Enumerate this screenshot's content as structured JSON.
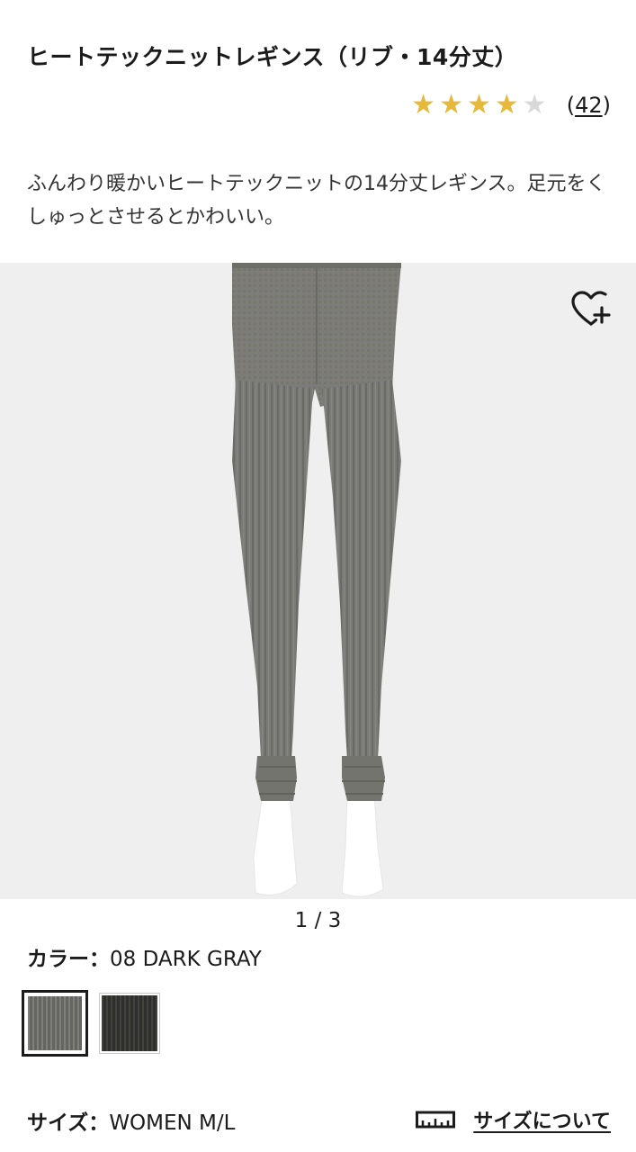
{
  "product": {
    "title": "ヒートテックニットレギンス（リブ・14分丈）",
    "rating": {
      "value": 4,
      "max": 5,
      "review_count": "(42)",
      "review_count_num": "42",
      "star_on_color": "#e6b93b",
      "star_off_color": "#d9d9d9"
    },
    "description": "ふんわり暖かいヒートテックニットの14分丈レギンス。足元をくしゅっとさせるとかわいい。"
  },
  "gallery": {
    "pager": "1 / 3",
    "favorite_icon": "heart-plus-icon",
    "image_subject": "gray-ribbed-leggings"
  },
  "color": {
    "label": "カラー：",
    "value": "08 DARK GRAY",
    "swatches": [
      {
        "name": "dark-gray",
        "color": "#6f706b",
        "selected": true
      },
      {
        "name": "black",
        "color": "#363733",
        "selected": false
      }
    ]
  },
  "size": {
    "label": "サイズ：",
    "value": "WOMEN  M/L",
    "guide_label": "サイズについて",
    "guide_icon": "ruler-icon"
  }
}
